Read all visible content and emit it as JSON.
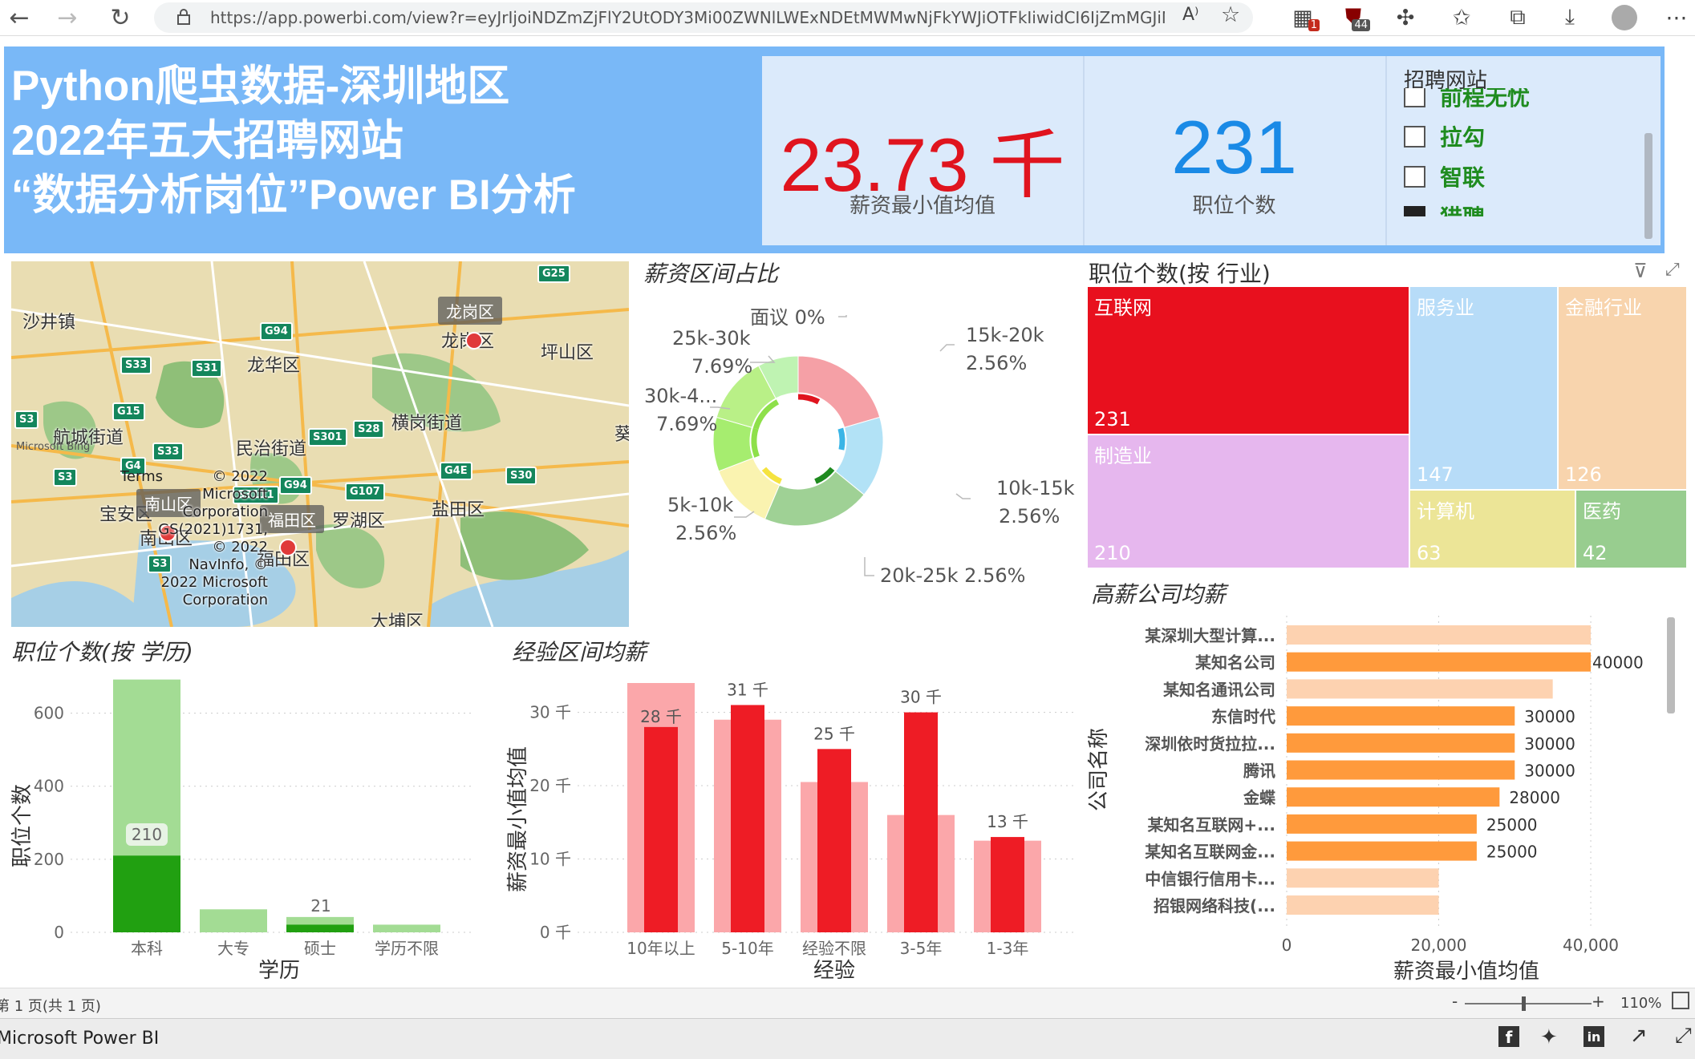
{
  "browser": {
    "url": "https://app.powerbi.com/view?r=eyJrIjoiNDZmZjFlY2UtODY3Mi00ZWNlLWExNDEtMWMwNjFkYWJiOTFkIiwidCI6IjZmMGJiNzJm...",
    "badges": {
      "extensions": "1",
      "ublock": "44"
    }
  },
  "header": {
    "title_line1": "Python爬虫数据-深圳地区",
    "title_line2": "2022年五大招聘网站",
    "title_line3": "“数据分析岗位”Power BI分析"
  },
  "kpis": [
    {
      "value": "23.73 千",
      "label": "薪资最小值均值",
      "color": "#e0141e"
    },
    {
      "value": "231",
      "label": "职位个数",
      "color": "#1a8ae6"
    }
  ],
  "slicer": {
    "title": "招聘网站",
    "items": [
      {
        "label": "前程无忧",
        "checked": false
      },
      {
        "label": "拉勾",
        "checked": false
      },
      {
        "label": "智联",
        "checked": false
      },
      {
        "label": "猎聘",
        "checked": true
      }
    ]
  },
  "map": {
    "places": [
      "沙井镇",
      "龙岗区",
      "龙岗区",
      "坪山区",
      "龙华区",
      "横岗街道",
      "航城街道",
      "民治街道",
      "宝安区",
      "南山区",
      "南山区",
      "福田区",
      "罗湖区",
      "盐田区",
      "福田区",
      "大埔区",
      "葵"
    ],
    "roads": [
      "G25",
      "G94",
      "S33",
      "S31",
      "G15",
      "S3",
      "S33",
      "S301",
      "S28",
      "G4",
      "S3",
      "S3111",
      "G94",
      "G107",
      "G4E",
      "S30",
      "S3"
    ],
    "watermark": "Microsoft Bing",
    "terms": "Terms",
    "copyright": [
      "© 2022",
      "Microsoft",
      "Corporation",
      "GS(2021)1731,",
      "© 2022",
      "NavInfo, ©",
      "2022 Microsoft",
      "Corporation"
    ]
  },
  "donut": {
    "title": "薪资区间占比",
    "labels": [
      {
        "name": "面议 0%"
      },
      {
        "name": "15k-20k",
        "pct": "2.56%"
      },
      {
        "name": "25k-30k",
        "pct": "7.69%"
      },
      {
        "name": "30k-4...",
        "pct": "7.69%"
      },
      {
        "name": "10k-15k",
        "pct": "2.56%"
      },
      {
        "name": "5k-10k",
        "pct": "2.56%"
      },
      {
        "name": "20k-25k 2.56%"
      }
    ]
  },
  "treemap": {
    "title": "职位个数(按 行业)",
    "items": [
      {
        "name": "互联网",
        "value": "231",
        "color": "#e8101e"
      },
      {
        "name": "制造业",
        "value": "210",
        "color": "#e6b7ee"
      },
      {
        "name": "服务业",
        "value": "147",
        "color": "#b7dcf8"
      },
      {
        "name": "金融行业",
        "value": "126",
        "color": "#f8d4ad"
      },
      {
        "name": "计算机",
        "value": "63",
        "color": "#ece597"
      },
      {
        "name": "医药",
        "value": "42",
        "color": "#98cd8f"
      }
    ]
  },
  "edu": {
    "title": "职位个数(按 学历)",
    "ylabel": "职位个数",
    "xlabel": "学历",
    "ticks": [
      "0",
      "200",
      "400",
      "600"
    ],
    "bar_label_1": "210",
    "bar_label_2": "21"
  },
  "exp": {
    "title": "经验区间均薪",
    "ylabel": "薪资最小值均值",
    "xlabel": "经验",
    "ticks": [
      "0 千",
      "10 千",
      "20 千",
      "30 千"
    ],
    "labels": [
      "28 千",
      "31 千",
      "25 千",
      "30 千",
      "13 千"
    ]
  },
  "top": {
    "title": "高薪公司均薪",
    "ylabel": "公司名称",
    "xlabel": "薪资最小值均值",
    "ticks": [
      "0",
      "20,000",
      "40,000"
    ],
    "labels": [
      "40000",
      "30000",
      "30000",
      "30000",
      "28000",
      "25000",
      "25000"
    ]
  },
  "chart_data": [
    {
      "type": "bar",
      "title": "职位个数(按 学历)",
      "xlabel": "学历",
      "ylabel": "职位个数",
      "categories": [
        "本科",
        "大专",
        "硕士",
        "学历不限"
      ],
      "ylim": [
        0,
        700
      ],
      "series": [
        {
          "values": [
            692,
            63,
            42,
            21
          ]
        },
        {
          "values": [
            210,
            0,
            21,
            0
          ]
        }
      ]
    },
    {
      "type": "bar",
      "title": "经验区间均薪",
      "xlabel": "经验",
      "ylabel": "薪资最小值均值",
      "categories": [
        "10年以上",
        "5-10年",
        "经验不限",
        "3-5年",
        "1-3年"
      ],
      "ylim": [
        0,
        34000
      ],
      "series": [
        {
          "values": [
            34000,
            29000,
            20500,
            16000,
            12500
          ]
        },
        {
          "values": [
            28000,
            31000,
            25000,
            30000,
            13000
          ]
        }
      ]
    },
    {
      "type": "bar",
      "orientation": "horizontal",
      "title": "高薪公司均薪",
      "xlabel": "薪资最小值均值",
      "ylabel": "公司名称",
      "categories": [
        "某深圳大型计算...",
        "某知名公司",
        "某知名通讯公司",
        "东信时代",
        "深圳依时货拉拉...",
        "腾讯",
        "金蝶",
        "某知名互联网+...",
        "某知名互联网金...",
        "中信银行信用卡...",
        "招银网络科技(..."
      ],
      "values": [
        40000,
        40000,
        35000,
        30000,
        30000,
        30000,
        28000,
        25000,
        25000,
        20000,
        20000
      ],
      "highlighted": [
        false,
        true,
        false,
        true,
        true,
        true,
        true,
        true,
        true,
        false,
        false
      ],
      "xlim": [
        0,
        42000
      ]
    },
    {
      "type": "pie",
      "title": "薪资区间占比",
      "categories": [
        "15k-20k",
        "10k-15k",
        "20k-25k",
        "5k-10k",
        "30k-4...",
        "25k-30k",
        "面议"
      ],
      "values": [
        20.5,
        15.4,
        20.5,
        12.8,
        10.3,
        12.8,
        7.7
      ],
      "highlighted_pct": [
        2.56,
        2.56,
        2.56,
        2.56,
        7.69,
        7.69,
        0
      ],
      "colors": [
        "#f5a0a6",
        "#b2e2f6",
        "#9fd195",
        "#faf3b0",
        "#a6ed6f",
        "#b9f087",
        "#bff3b2"
      ]
    }
  ],
  "status": {
    "page": "第 1 页(共 1 页)",
    "zoom": "110%",
    "zoom_minus": "-",
    "zoom_plus": "+",
    "zoom_level": 0.45
  },
  "footer": {
    "brand": "Microsoft Power BI"
  }
}
